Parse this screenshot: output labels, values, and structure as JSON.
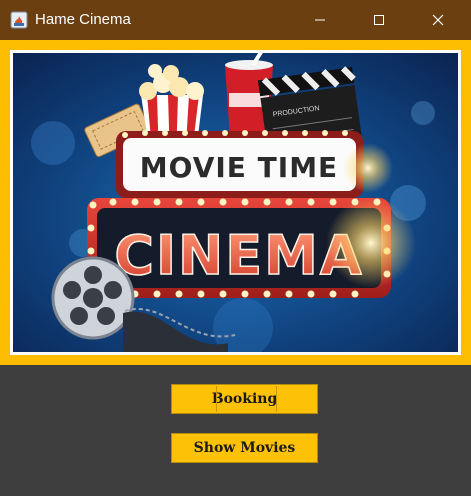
{
  "window": {
    "title": "Hame Cinema",
    "icon": "java-app-icon"
  },
  "poster": {
    "headline": "MOVIE TIME",
    "marquee": "CINEMA",
    "clapper_text": "PRODUCTION"
  },
  "buttons": {
    "booking": "Booking",
    "show_movies": "Show Movies"
  },
  "colors": {
    "titlebar": "#6b3f10",
    "frame": "#fcbd00",
    "button": "#fdc108",
    "background": "#3e3e3e"
  }
}
